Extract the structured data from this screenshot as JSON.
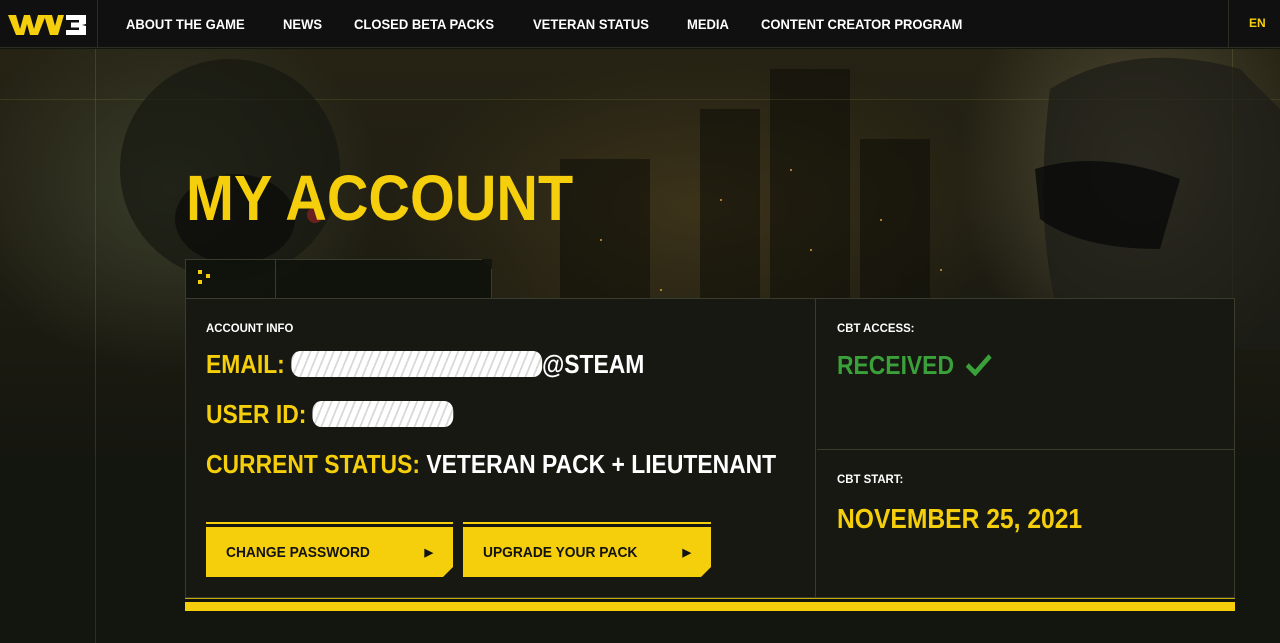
{
  "brand": {
    "logo_text": "WW3",
    "accent": "#f5cf0c",
    "success": "#3aa13a"
  },
  "nav": {
    "items": [
      {
        "label": "ABOUT THE GAME"
      },
      {
        "label": "NEWS"
      },
      {
        "label": "CLOSED BETA PACKS"
      },
      {
        "label": "VETERAN STATUS"
      },
      {
        "label": "MEDIA"
      },
      {
        "label": "CONTENT CREATOR PROGRAM"
      }
    ],
    "language": "EN"
  },
  "hero": {
    "title": "MY ACCOUNT"
  },
  "account_info": {
    "heading": "ACCOUNT INFO",
    "email_label": "EMAIL:",
    "email_suffix": "@STEAM",
    "user_id_label": "USER ID:",
    "status_label": "CURRENT STATUS:",
    "status_value": "VETERAN PACK + LIEUTENANT",
    "change_password_label": "CHANGE PASSWORD",
    "upgrade_pack_label": "UPGRADE YOUR PACK",
    "arrow_glyph": "▶"
  },
  "cbt": {
    "access_label": "CBT ACCESS:",
    "access_value": "RECEIVED",
    "start_label": "CBT START:",
    "start_value": "NOVEMBER 25, 2021"
  },
  "icons": {
    "check": "check-icon",
    "logo": "ww3-logo-icon",
    "tab_dots": "dots-grid-icon"
  }
}
